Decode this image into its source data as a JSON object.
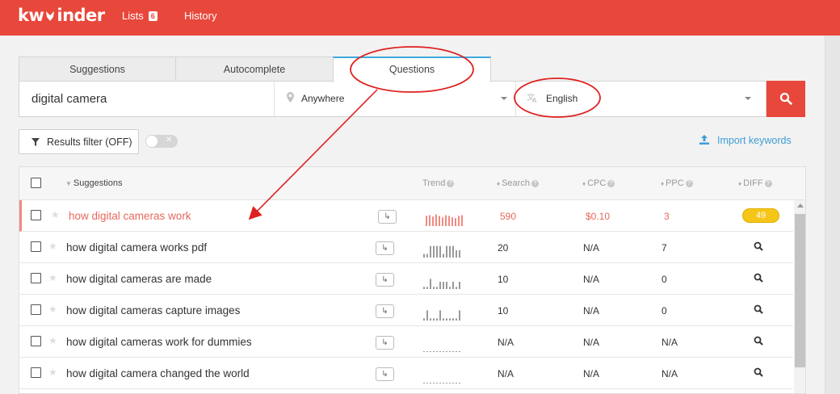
{
  "app": {
    "logo_text_left": "kw",
    "logo_text_right": "inder"
  },
  "nav": {
    "lists_label": "Lists",
    "lists_count": "6",
    "history_label": "History"
  },
  "tabs": [
    {
      "label": "Suggestions",
      "active": false
    },
    {
      "label": "Autocomplete",
      "active": false
    },
    {
      "label": "Questions",
      "active": true
    }
  ],
  "search": {
    "keyword": "digital camera",
    "location": "Anywhere",
    "language": "English"
  },
  "filter": {
    "label": "Results filter (OFF)",
    "toggle_state": "off"
  },
  "import": {
    "label": "Import keywords"
  },
  "table": {
    "headers": {
      "suggestions": "Suggestions",
      "trend": "Trend",
      "search": "Search",
      "cpc": "CPC",
      "ppc": "PPC",
      "diff": "DIFF"
    },
    "rows": [
      {
        "keyword": "how digital cameras work",
        "search": "590",
        "cpc": "$0.10",
        "ppc": "3",
        "diff": "49",
        "active": true,
        "trend": [
          0.7,
          0.75,
          0.65,
          0.8,
          0.7,
          0.6,
          0.75,
          0.7,
          0.6,
          0.55,
          0.7,
          0.75
        ]
      },
      {
        "keyword": "how digital camera works pdf",
        "search": "20",
        "cpc": "N/A",
        "ppc": "7",
        "diff": "",
        "active": false,
        "trend": [
          0.25,
          0.25,
          0.8,
          0.8,
          0.8,
          0.8,
          0.25,
          0.8,
          0.8,
          0.8,
          0.5,
          0.5
        ]
      },
      {
        "keyword": "how digital cameras are made",
        "search": "10",
        "cpc": "N/A",
        "ppc": "0",
        "diff": "",
        "active": false,
        "trend": [
          0.15,
          0.15,
          0.7,
          0.15,
          0.15,
          0.5,
          0.5,
          0.5,
          0.15,
          0.5,
          0.15,
          0.5
        ]
      },
      {
        "keyword": "how digital cameras capture images",
        "search": "10",
        "cpc": "N/A",
        "ppc": "0",
        "diff": "",
        "active": false,
        "trend": [
          0.15,
          0.7,
          0.15,
          0.15,
          0.15,
          0.7,
          0.15,
          0.15,
          0.15,
          0.15,
          0.15,
          0.7
        ]
      },
      {
        "keyword": "how digital cameras work for dummies",
        "search": "N/A",
        "cpc": "N/A",
        "ppc": "N/A",
        "diff": "",
        "active": false,
        "trend": [
          0.05,
          0.05,
          0.05,
          0.05,
          0.05,
          0.05,
          0.05,
          0.05,
          0.05,
          0.05,
          0.05,
          0.05
        ]
      },
      {
        "keyword": "how digital camera changed the world",
        "search": "N/A",
        "cpc": "N/A",
        "ppc": "N/A",
        "diff": "",
        "active": false,
        "trend": [
          0.05,
          0.05,
          0.05,
          0.05,
          0.05,
          0.05,
          0.05,
          0.05,
          0.05,
          0.05,
          0.05,
          0.05
        ]
      }
    ]
  },
  "colors": {
    "brand": "#e8473b",
    "accent": "#3da6dc",
    "active_text": "#e8695d",
    "diff_badge": "#f5c518",
    "annotation": "#e02020"
  },
  "icons": [
    "fox-logo-icon",
    "pin-icon",
    "translate-icon",
    "search-icon",
    "filter-icon",
    "upload-icon",
    "star-icon",
    "arrow-return-icon",
    "magnifier-icon",
    "help-icon"
  ]
}
